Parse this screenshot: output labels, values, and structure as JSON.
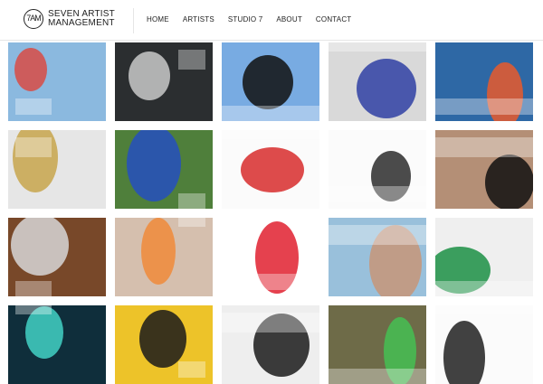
{
  "brand": {
    "mark": "7AM",
    "line1": "SEVEN ARTIST",
    "line2": "MANAGEMENT"
  },
  "nav": {
    "items": [
      {
        "label": "HOME"
      },
      {
        "label": "ARTISTS"
      },
      {
        "label": "STUDIO 7"
      },
      {
        "label": "ABOUT"
      },
      {
        "label": "CONTACT"
      }
    ]
  },
  "gallery": {
    "tiles": [
      {
        "subject": "swimmer-underwater",
        "bg": "#8bb9df",
        "accent": "#d84b45"
      },
      {
        "subject": "silver-suit-figure",
        "bg": "#2c2f31",
        "accent": "#c9c9c9"
      },
      {
        "subject": "group-black-swimwear",
        "bg": "#7aaee6",
        "accent": "#111111"
      },
      {
        "subject": "two-models-seated",
        "bg": "#d9d9d9",
        "accent": "#2f3fa3"
      },
      {
        "subject": "two-faces-closeup",
        "bg": "#2f6aa8",
        "accent": "#e85a2b"
      },
      {
        "subject": "two-lying-down",
        "bg": "#eaeaea",
        "accent": "#c7a54b"
      },
      {
        "subject": "blue-figures-grass",
        "bg": "#4f7f3b",
        "accent": "#244fbf"
      },
      {
        "subject": "red-dress-bed",
        "bg": "#ffffff",
        "accent": "#d72b2b"
      },
      {
        "subject": "monochrome-face-art",
        "bg": "#ffffff",
        "accent": "#2b2b2b"
      },
      {
        "subject": "street-portrait",
        "bg": "#b48f76",
        "accent": "#111111"
      },
      {
        "subject": "white-outfit-doorway",
        "bg": "#7a4a2a",
        "accent": "#d7d7d7"
      },
      {
        "subject": "orange-sunglasses",
        "bg": "#d9c3b1",
        "accent": "#f08a3a"
      },
      {
        "subject": "red-lips",
        "bg": "#ffffff",
        "accent": "#e0202f"
      },
      {
        "subject": "shirtless-group",
        "bg": "#9cc4df",
        "accent": "#c79578"
      },
      {
        "subject": "pink-green-coats",
        "bg": "#f3f3f3",
        "accent": "#1b8f44"
      },
      {
        "subject": "teal-portrait",
        "bg": "#0f2e3b",
        "accent": "#42d1c6"
      },
      {
        "subject": "yellow-wall-room",
        "bg": "#f1c72a",
        "accent": "#1a1a1a"
      },
      {
        "subject": "checkerboard-floor",
        "bg": "#f2f2f2",
        "accent": "#1a1a1a"
      },
      {
        "subject": "green-tops-duo",
        "bg": "#6e6b48",
        "accent": "#45c054"
      },
      {
        "subject": "white-hair-profile",
        "bg": "#ffffff",
        "accent": "#202020"
      }
    ]
  }
}
